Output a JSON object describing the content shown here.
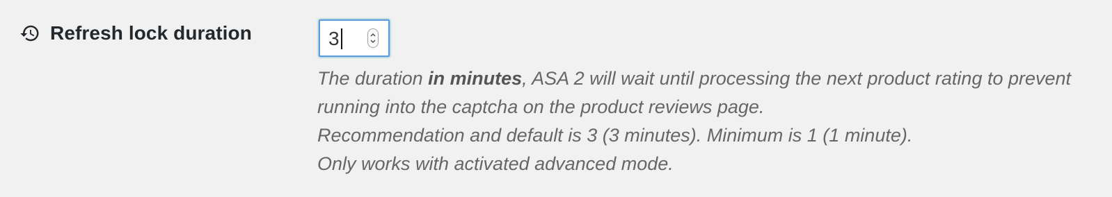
{
  "setting": {
    "label": "Refresh lock duration",
    "icon": "history-icon",
    "input_value": "3"
  },
  "description": {
    "line1_before": "The duration ",
    "line1_bold": "in minutes",
    "line1_after": ", ASA 2 will wait until processing the next product rating to prevent running into the captcha on the product reviews page.",
    "line2": "Recommendation and default is 3 (3 minutes). Minimum is 1 (1 minute).",
    "line3": "Only works with activated advanced mode."
  },
  "colors": {
    "background": "#f1f1f1",
    "focus_border": "#5b9dd9",
    "description_text": "#666666"
  }
}
